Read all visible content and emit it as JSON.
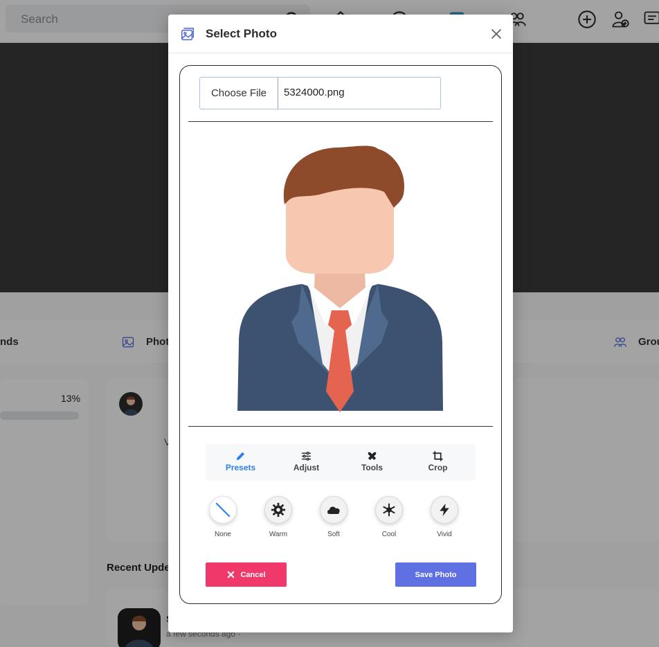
{
  "background": {
    "search_placeholder": "Search",
    "tabs": [
      {
        "label": "nds"
      },
      {
        "label": "Phot"
      },
      {
        "label": "Grou"
      }
    ],
    "progress_percent": "13%",
    "recent_title": "Recent Upde",
    "post_initial": "V",
    "author_initial": "S",
    "time_ago": "a few seconds ago ·"
  },
  "modal": {
    "title": "Select Photo",
    "file_input": {
      "button_label": "Choose File",
      "file_name": "5324000.png"
    },
    "tool_tabs": [
      {
        "label": "Presets",
        "icon": "pencil-icon",
        "active": true
      },
      {
        "label": "Adjust",
        "icon": "sliders-icon",
        "active": false
      },
      {
        "label": "Tools",
        "icon": "tools-icon",
        "active": false
      },
      {
        "label": "Crop",
        "icon": "crop-icon",
        "active": false
      }
    ],
    "presets": [
      {
        "label": "None",
        "icon": "none-slash-icon",
        "selected": true
      },
      {
        "label": "Warm",
        "icon": "sun-gear-icon",
        "selected": false
      },
      {
        "label": "Soft",
        "icon": "cloud-icon",
        "selected": false
      },
      {
        "label": "Cool",
        "icon": "snowflake-icon",
        "selected": false
      },
      {
        "label": "Vivid",
        "icon": "lightning-icon",
        "selected": false
      }
    ],
    "cancel_label": "Cancel",
    "save_label": "Save Photo"
  },
  "colors": {
    "accent_blue": "#2f80ed",
    "cancel_red": "#f0386b",
    "save_indigo": "#5f70e3",
    "overlay": "rgba(0,0,0,0.36)"
  }
}
